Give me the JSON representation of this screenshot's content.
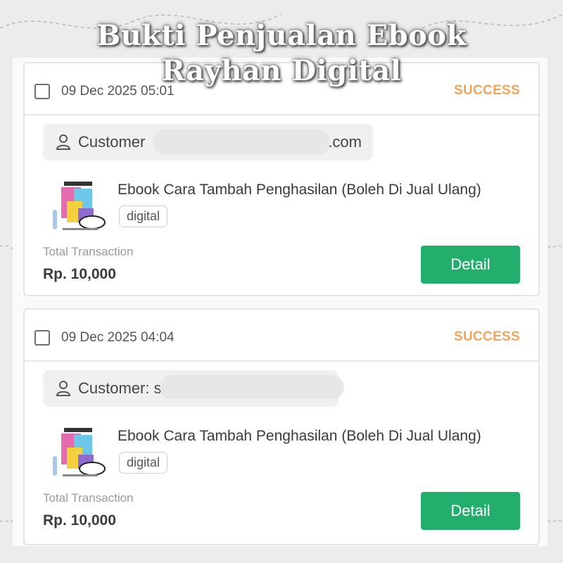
{
  "headline": {
    "line1": "Bukti Penjualan Ebook",
    "line2": "Rayhan Digital"
  },
  "colors": {
    "success": "#f0a55a",
    "detail_button": "#24ae6e",
    "background": "#ececec"
  },
  "transactions": [
    {
      "date": "09 Dec 2025 05:01",
      "status": "SUCCESS",
      "customer_label": "Customer",
      "customer_suffix": ".com",
      "product_title": "Ebook Cara Tambah Penghasilan (Boleh Di Jual Ulang)",
      "product_tag": "digital",
      "total_label": "Total Transaction",
      "total_value": "Rp. 10,000",
      "detail_label": "Detail"
    },
    {
      "date": "09 Dec 2025 04:04",
      "status": "SUCCESS",
      "customer_label": "Customer: s",
      "customer_suffix": "",
      "product_title": "Ebook Cara Tambah Penghasilan (Boleh Di Jual Ulang)",
      "product_tag": "digital",
      "total_label": "Total Transaction",
      "total_value": "Rp. 10,000",
      "detail_label": "Detail"
    }
  ]
}
